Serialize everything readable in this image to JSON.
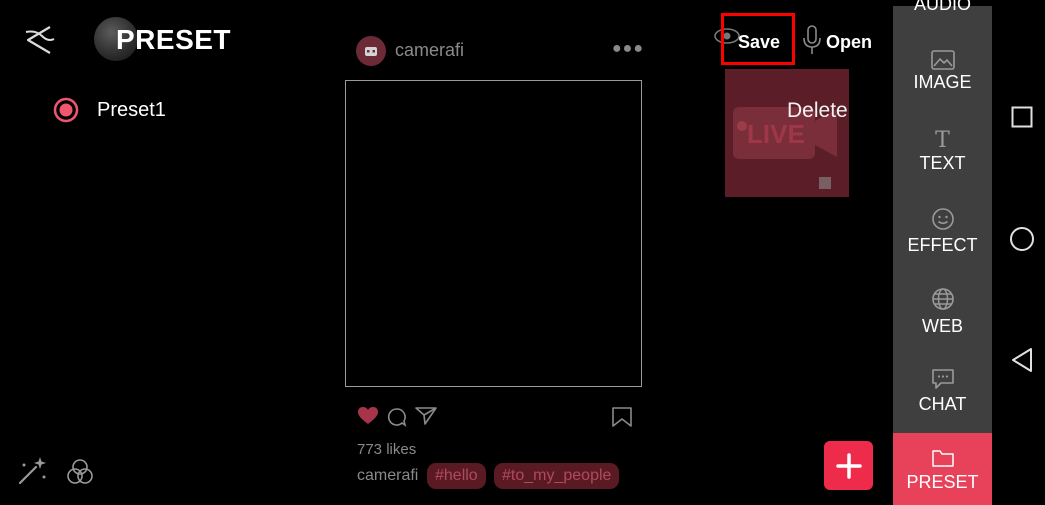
{
  "header": {
    "title": "PRESET"
  },
  "presets": [
    {
      "label": "Preset1",
      "selected": true
    }
  ],
  "post": {
    "username": "camerafi",
    "likes": "773 likes",
    "caption_user": "camerafi",
    "hashtags": [
      "#hello",
      "#to_my_people"
    ]
  },
  "actions": {
    "save_label": "Save",
    "open_label": "Open",
    "delete_label": "Delete"
  },
  "thumbnail": {
    "badge_text": "LIVE"
  },
  "side_menu": {
    "items": [
      {
        "label": "AUDIO",
        "icon": "audio-icon"
      },
      {
        "label": "IMAGE",
        "icon": "image-icon"
      },
      {
        "label": "TEXT",
        "icon": "text-icon"
      },
      {
        "label": "EFFECT",
        "icon": "effect-icon"
      },
      {
        "label": "WEB",
        "icon": "web-icon"
      },
      {
        "label": "CHAT",
        "icon": "chat-icon"
      },
      {
        "label": "PRESET",
        "icon": "folder-icon",
        "active": true
      }
    ]
  },
  "colors": {
    "accent": "#e8415a",
    "highlight_box": "#ff0000",
    "menu_bg": "#3f3f3f",
    "fab": "#ee2b4a"
  }
}
